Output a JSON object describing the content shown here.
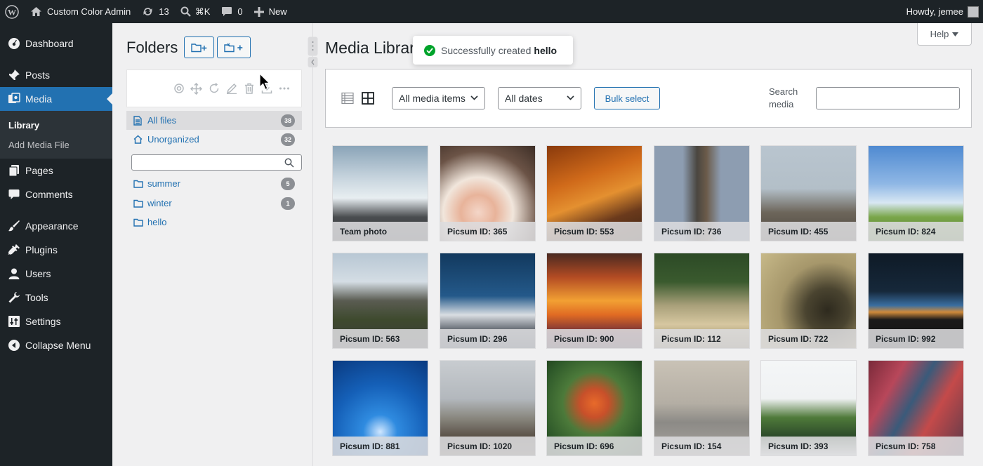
{
  "adminbar": {
    "site_name": "Custom Color Admin",
    "updates_count": "13",
    "search_shortcut": "⌘K",
    "comments_count": "0",
    "new_label": "New",
    "howdy": "Howdy, jemee"
  },
  "sidebar": {
    "items": [
      {
        "label": "Dashboard",
        "icon": "dashboard-icon"
      },
      {
        "label": "Posts",
        "icon": "pin-icon"
      },
      {
        "label": "Media",
        "icon": "media-icon"
      },
      {
        "label": "Pages",
        "icon": "pages-icon"
      },
      {
        "label": "Comments",
        "icon": "comments-icon"
      },
      {
        "label": "Appearance",
        "icon": "brush-icon"
      },
      {
        "label": "Plugins",
        "icon": "plugin-icon"
      },
      {
        "label": "Users",
        "icon": "users-icon"
      },
      {
        "label": "Tools",
        "icon": "wrench-icon"
      },
      {
        "label": "Settings",
        "icon": "settings-icon"
      },
      {
        "label": "Collapse Menu",
        "icon": "collapse-icon"
      }
    ],
    "submenu": [
      "Library",
      "Add Media File"
    ],
    "accent_color": "#2271b1"
  },
  "folders": {
    "title": "Folders",
    "all_files": {
      "label": "All files",
      "count": "38"
    },
    "unorganized": {
      "label": "Unorganized",
      "count": "32"
    },
    "search_placeholder": "",
    "list": [
      {
        "label": "summer",
        "count": "5"
      },
      {
        "label": "winter",
        "count": "1"
      },
      {
        "label": "hello",
        "count": ""
      }
    ]
  },
  "main": {
    "title": "Media Library",
    "help_label": "Help",
    "toast": {
      "prefix": "Successfully created",
      "name": "hello"
    },
    "filter_type": "All media items",
    "filter_date": "All dates",
    "bulk_label": "Bulk select",
    "search_label": "Search media",
    "search_value": ""
  },
  "media": [
    {
      "caption": "Team photo"
    },
    {
      "caption": "Picsum ID: 365"
    },
    {
      "caption": "Picsum ID: 553"
    },
    {
      "caption": "Picsum ID: 736"
    },
    {
      "caption": "Picsum ID: 455"
    },
    {
      "caption": "Picsum ID: 824"
    },
    {
      "caption": "Picsum ID: 563"
    },
    {
      "caption": "Picsum ID: 296"
    },
    {
      "caption": "Picsum ID: 900"
    },
    {
      "caption": "Picsum ID: 112"
    },
    {
      "caption": "Picsum ID: 722"
    },
    {
      "caption": "Picsum ID: 992"
    },
    {
      "caption": "Picsum ID: 881"
    },
    {
      "caption": "Picsum ID: 1020"
    },
    {
      "caption": "Picsum ID: 696"
    },
    {
      "caption": "Picsum ID: 154"
    },
    {
      "caption": "Picsum ID: 393"
    },
    {
      "caption": "Picsum ID: 758"
    }
  ]
}
